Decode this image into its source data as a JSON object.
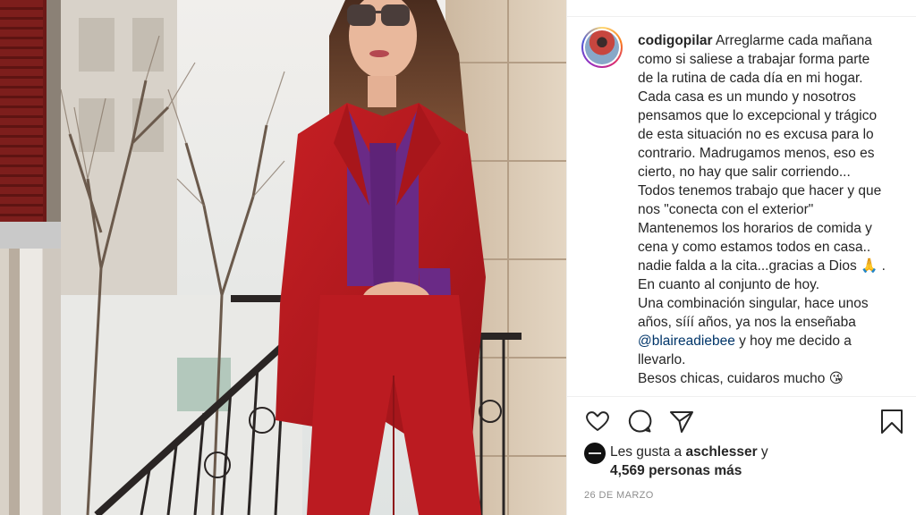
{
  "post": {
    "username": "codigopilar",
    "caption_lines": [
      "Arreglarme cada mañana",
      "como si saliese a trabajar forma parte",
      "de la rutina de cada día en mi hogar.",
      "Cada casa es un mundo y nosotros",
      "pensamos que lo excepcional y trágico",
      "de esta situación no es excusa para lo",
      "contrario. Madrugamos menos, eso es",
      "cierto, no hay que salir corriendo...",
      "Todos tenemos trabajo que hacer y que",
      "nos \"conecta con el exterior\"",
      "Mantenemos los horarios de comida y",
      "cena y como estamos todos en casa..",
      "nadie falda a la cita...gracias a Dios 🙏 .",
      "En cuanto al conjunto de hoy.",
      "Una combinación singular, hace unos",
      "años, sííí años, ya nos la enseñaba"
    ],
    "mention": "@blaireadiebee",
    "after_mention": " y hoy me decido a",
    "caption_tail": [
      "llevarlo.",
      "Besos chicas, cuidaros mucho 😘"
    ],
    "likes_prefix": "Les gusta a ",
    "likes_user": "aschlesser",
    "likes_suffix": " y",
    "likes_count": "4,569 personas más",
    "date": "26 DE MARZO"
  },
  "icons": [
    "heart-icon",
    "comment-icon",
    "share-icon",
    "bookmark-icon"
  ],
  "colors": {
    "suit_red": "#b8191f",
    "blouse_purple": "#6a2a86",
    "mention_blue": "#003569",
    "muted_gray": "#8e8e8e"
  }
}
